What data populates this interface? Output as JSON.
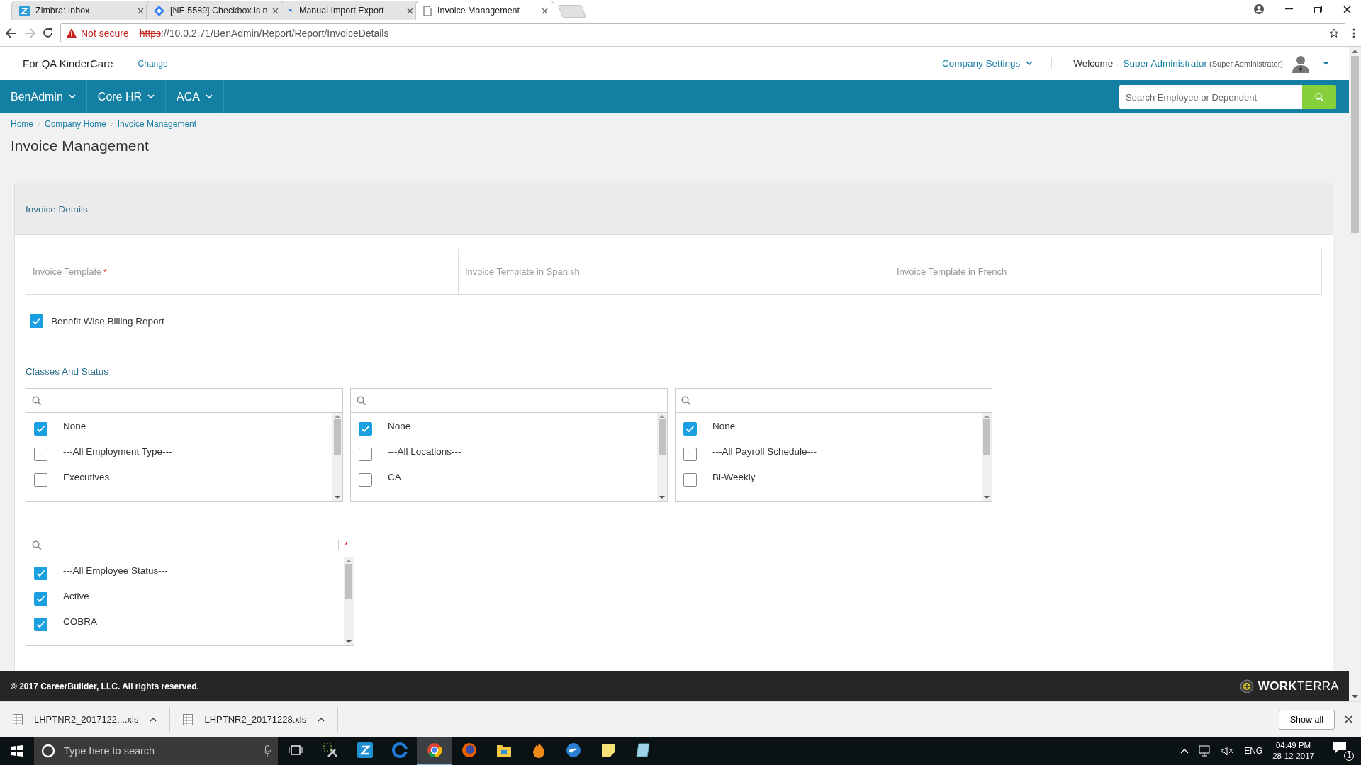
{
  "browser": {
    "tabs": [
      {
        "title": "Zimbra: Inbox",
        "kind": "zimbra",
        "selected": false
      },
      {
        "title": "[NF-5589] Checkbox is n",
        "kind": "diamond",
        "selected": false
      },
      {
        "title": "Manual Import Export",
        "kind": "spinner",
        "selected": false
      },
      {
        "title": "Invoice Management",
        "kind": "page",
        "selected": true
      }
    ],
    "address": {
      "security": "Not secure",
      "scheme": "https",
      "rest": "://10.0.2.71/BenAdmin/Report/Report/InvoiceDetails"
    }
  },
  "header": {
    "company": "For QA KinderCare",
    "change": "Change",
    "company_settings": "Company Settings",
    "welcome": "Welcome -",
    "user": "Super Administrator",
    "role": "(Super Administrator)"
  },
  "nav": {
    "menus": [
      "BenAdmin",
      "Core HR",
      "ACA"
    ],
    "search_placeholder": "Search Employee or Dependent"
  },
  "breadcrumb": [
    "Home",
    "Company Home",
    "Invoice Management"
  ],
  "page_title": "Invoice Management",
  "panel": {
    "title": "Invoice Details",
    "template_fields": [
      {
        "label": "Invoice Template",
        "required_mark": "*"
      },
      {
        "label": "Invoice Template in Spanish"
      },
      {
        "label": "Invoice Template in French"
      }
    ],
    "billing_checkbox": {
      "label": "Benefit Wise Billing Report",
      "checked": true
    },
    "section_title": "Classes And Status",
    "lists": [
      {
        "items": [
          {
            "label": "None",
            "checked": true
          },
          {
            "label": "---All Employment Type---",
            "checked": false
          },
          {
            "label": "Executives",
            "checked": false
          }
        ]
      },
      {
        "items": [
          {
            "label": "None",
            "checked": true
          },
          {
            "label": "---All Locations---",
            "checked": false
          },
          {
            "label": "CA",
            "checked": false
          }
        ]
      },
      {
        "items": [
          {
            "label": "None",
            "checked": true
          },
          {
            "label": "---All Payroll Schedule---",
            "checked": false
          },
          {
            "label": "Bi-Weekly",
            "checked": false
          }
        ]
      },
      {
        "required_mark": "*",
        "items": [
          {
            "label": "---All Employee Status---",
            "checked": true
          },
          {
            "label": "Active",
            "checked": true
          },
          {
            "label": "COBRA",
            "checked": true
          }
        ]
      }
    ]
  },
  "footer": {
    "copyright": "© 2017 CareerBuilder, LLC. All rights reserved.",
    "logo": "**WORK**TERRA"
  },
  "downloads": {
    "files": [
      "LHPTNR2_2017122....xls",
      "LHPTNR2_20171228.xls"
    ],
    "show_all": "Show all"
  },
  "taskbar": {
    "search_placeholder": "Type here to search",
    "apps": [
      {
        "kind": "tools",
        "active": false
      },
      {
        "kind": "zimbra",
        "active": false
      },
      {
        "kind": "edge",
        "active": false
      },
      {
        "kind": "chrome",
        "active": true
      },
      {
        "kind": "firefox",
        "active": false
      },
      {
        "kind": "folder",
        "active": false
      },
      {
        "kind": "flame",
        "active": false
      },
      {
        "kind": "bird",
        "active": false
      },
      {
        "kind": "note",
        "active": false
      },
      {
        "kind": "notepad",
        "active": false
      }
    ],
    "language": "ENG",
    "time": "04:49 PM",
    "date": "28-12-2017",
    "notifications": "1"
  }
}
